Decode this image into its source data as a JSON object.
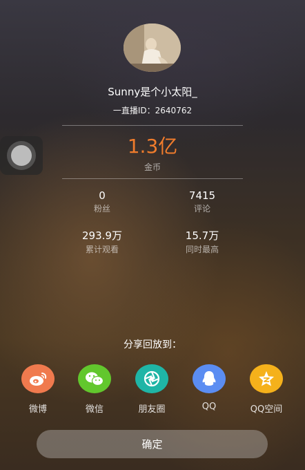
{
  "profile": {
    "username": "Sunny是个小太阳_",
    "user_id": "一直播ID：2640762"
  },
  "coins": {
    "value": "1.3亿",
    "label": "金币"
  },
  "stats": [
    {
      "value": "0",
      "label": "粉丝"
    },
    {
      "value": "7415",
      "label": "评论"
    },
    {
      "value": "293.9万",
      "label": "累计观看"
    },
    {
      "value": "15.7万",
      "label": "同时最高"
    }
  ],
  "share": {
    "title": "分享回放到：",
    "items": [
      {
        "label": "微博",
        "icon": "weibo-icon",
        "color": "#f07a4e"
      },
      {
        "label": "微信",
        "icon": "wechat-icon",
        "color": "#62c72d"
      },
      {
        "label": "朋友圈",
        "icon": "moments-icon",
        "color": "#1fb5a6"
      },
      {
        "label": "QQ",
        "icon": "qq-icon",
        "color": "#5b8df2"
      },
      {
        "label": "QQ空间",
        "icon": "qzone-icon",
        "color": "#f5b11b"
      }
    ]
  },
  "confirm_label": "确定",
  "colors": {
    "accent": "#f07c2c"
  }
}
